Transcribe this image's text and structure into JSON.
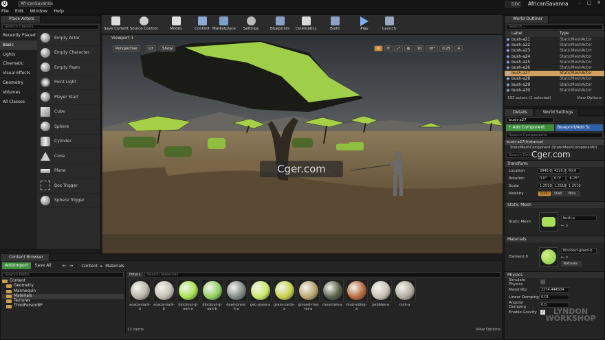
{
  "window": {
    "doc_tab": "AfricanSavanna",
    "menu": [
      "File",
      "Edit",
      "Window",
      "Help"
    ],
    "ddc_label": "DDC",
    "project_name": "AfricanSavanna"
  },
  "place_actors": {
    "tab": "Place Actors",
    "search_placeholder": "Search Classes",
    "categories": [
      "Recently Placed",
      "Basic",
      "Lights",
      "Cinematic",
      "Visual Effects",
      "Geometry",
      "Volumes",
      "All Classes"
    ],
    "active_category": "Basic",
    "actors": [
      "Empty Actor",
      "Empty Character",
      "Empty Pawn",
      "Point Light",
      "Player Start",
      "Cube",
      "Sphere",
      "Cylinder",
      "Cone",
      "Plane",
      "Box Trigger",
      "Sphere Trigger"
    ]
  },
  "toolbar": {
    "buttons": [
      "Save Current",
      "Source Control",
      "Modes",
      "Content",
      "Marketplace",
      "Settings",
      "Blueprints",
      "Cinematics",
      "Build",
      "Play",
      "Launch"
    ]
  },
  "viewport": {
    "tab": "Viewport 1",
    "perspective": "Perspective",
    "lit": "Lit",
    "show": "Show",
    "grid_snap": "10",
    "rot_snap": "10°",
    "scale_snap": "0.25",
    "cam_speed": "4",
    "watermark": "Cger.com"
  },
  "outliner": {
    "tab": "World Outliner",
    "search_placeholder": "Search...",
    "col_label": "Label",
    "col_type": "Type",
    "rows": [
      {
        "label": "bush-a21",
        "type": "StaticMeshActor"
      },
      {
        "label": "bush-a22",
        "type": "StaticMeshActor"
      },
      {
        "label": "bush-a23",
        "type": "StaticMeshActor"
      },
      {
        "label": "bush-a24",
        "type": "StaticMeshActor"
      },
      {
        "label": "bush-a25",
        "type": "StaticMeshActor"
      },
      {
        "label": "bush-a26",
        "type": "StaticMeshActor"
      },
      {
        "label": "bush-a27",
        "type": "StaticMeshActor"
      },
      {
        "label": "bush-a28",
        "type": "StaticMeshActor"
      },
      {
        "label": "bush-a29",
        "type": "StaticMeshActor"
      },
      {
        "label": "bush-a30",
        "type": "StaticMeshActor"
      }
    ],
    "selected_index": 6,
    "status": "193 actors (1 selected)",
    "view_options": "View Options"
  },
  "details": {
    "tab": "Details",
    "tab2": "World Settings",
    "name_value": "bush-a27",
    "add_component": "+ Add Component",
    "blueprint_btn": "Blueprint/Add Sc",
    "search_components": "Search Components",
    "instance_row": "bush-a27(Instance)",
    "component_row": "StaticMeshComponent (StaticMeshComponent0)",
    "search_details": "Search Details",
    "watermark": "Cger.com",
    "transform_header": "Transform",
    "location_label": "Location",
    "rotation_label": "Rotation",
    "scale_label": "Scale",
    "mobility_label": "Mobility",
    "location": [
      "3940.0",
      "4220.0",
      "60.0"
    ],
    "rotation": [
      "0.0°",
      "0.0°",
      "-6.25°"
    ],
    "scale": [
      "1.2510",
      "1.2510",
      "1.2510"
    ],
    "mobility": [
      "Static",
      "Stati",
      "Mov"
    ],
    "static_mesh_header": "Static Mesh",
    "static_mesh_label": "Static Mesh",
    "static_mesh_value": "bush-a",
    "materials_header": "Materials",
    "element_label": "Element 0",
    "material_value": "blockout-green-b",
    "textures_btn": "Textures",
    "physics_header": "Physics",
    "simulate_physics": "Simulate Physics",
    "mass_label": "MassInKg",
    "mass_value": "2274.444504",
    "linear_damping_label": "Linear Damping",
    "linear_damping": "0.01",
    "angular_damping_label": "Angular Damping",
    "angular_damping": "0.0",
    "enable_gravity": "Enable Gravity",
    "corner_watermark": "LYNDON WORKSHOP"
  },
  "content_browser": {
    "tab": "Content Browser",
    "add_import": "Add/Import",
    "save_all": "Save All",
    "path": [
      "Content",
      "Materials"
    ],
    "search_paths": "Search Paths",
    "filters": "Filters",
    "search_materials": "Search Materials",
    "tree": [
      "Content",
      "Geometry",
      "Mannequin",
      "Materials",
      "Textures",
      "ThirdPersonBP"
    ],
    "assets": [
      {
        "name": "acacia-bark-a",
        "color": "#b9b4a6"
      },
      {
        "name": "acacia-bark-b",
        "color": "#c4c0b6"
      },
      {
        "name": "blockout-green-a",
        "color": "#a8e050"
      },
      {
        "name": "blockout-green-b",
        "color": "#8fd060"
      },
      {
        "name": "dead-branch-a",
        "color": "#7f8a86"
      },
      {
        "name": "gec-grass-a",
        "color": "#c9e86a"
      },
      {
        "name": "grass-cards-a",
        "color": "#c7d24a"
      },
      {
        "name": "ground-master-a",
        "color": "#b9a66b"
      },
      {
        "name": "mountain-a",
        "color": "#556048"
      },
      {
        "name": "mud-siding-a",
        "color": "#b86a3c"
      },
      {
        "name": "pebbles-a",
        "color": "#c9c2b4"
      },
      {
        "name": "rock-a",
        "color": "#b2ac9e"
      }
    ],
    "item_count": "12 items",
    "view_options": "View Options"
  }
}
